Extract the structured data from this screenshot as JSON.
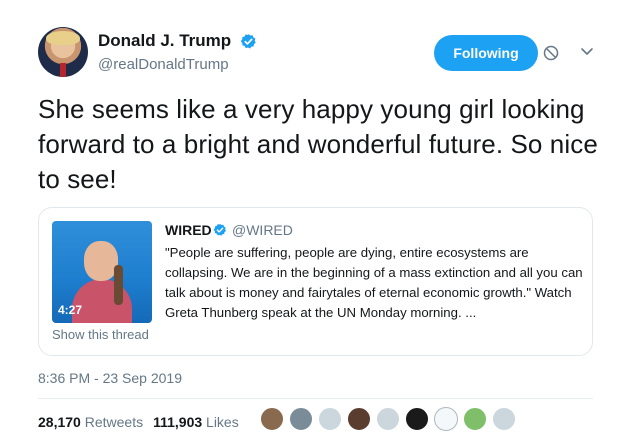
{
  "author": {
    "name": "Donald J. Trump",
    "handle": "@realDonaldTrump",
    "verified": true
  },
  "actions": {
    "follow_label": "Following",
    "block_icon": "block-icon",
    "menu_icon": "chevron-down-icon"
  },
  "tweet": {
    "text": "She seems like a very happy young girl looking forward to a bright and wonderful future. So nice to see!",
    "timestamp": "8:36 PM - 23 Sep 2019"
  },
  "quoted": {
    "name": "WIRED",
    "handle": "@WIRED",
    "verified": true,
    "text": "\"People are suffering, people are dying, entire ecosystems are collapsing. We are in the beginning of a mass extinction and all you can talk about is money and fairytales of eternal economic growth.\" Watch Greta Thunberg speak at the UN Monday morning. ...",
    "video_duration": "4:27",
    "show_thread": "Show this thread"
  },
  "stats": {
    "retweets_count": "28,170",
    "retweets_label": "Retweets",
    "likes_count": "111,903",
    "likes_label": "Likes"
  },
  "likers": [
    {
      "color": "#8a6a4f"
    },
    {
      "color": "#7b8c99"
    },
    {
      "color": "#ccd6dd"
    },
    {
      "color": "#5a3d2e"
    },
    {
      "color": "#ccd6dd"
    },
    {
      "color": "#1a1a1a"
    },
    {
      "color": "#f5f8fa"
    },
    {
      "color": "#7fbf6a"
    },
    {
      "color": "#ccd6dd"
    }
  ],
  "colors": {
    "accent": "#1da1f2",
    "muted": "#657786",
    "text": "#14171a"
  }
}
